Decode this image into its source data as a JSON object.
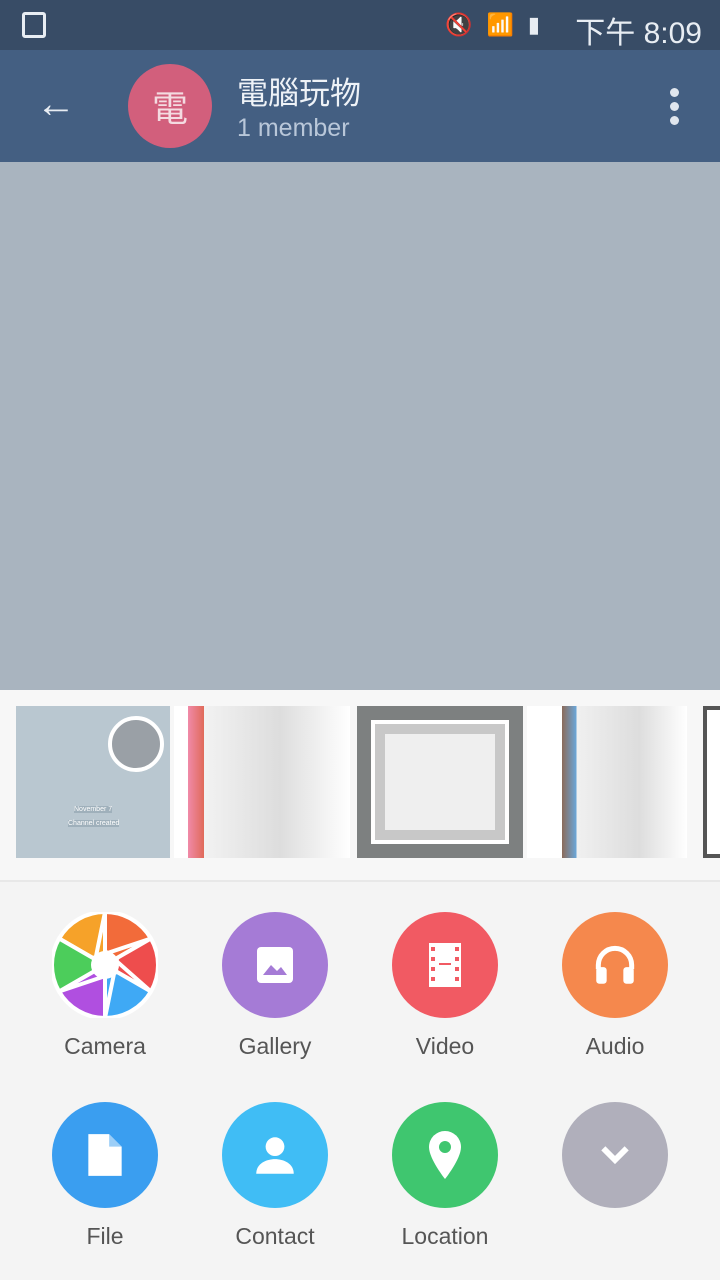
{
  "status_bar": {
    "time": "下午 8:09",
    "icons": [
      "screenshot-icon",
      "vibrate-mute-icon",
      "wifi-icon",
      "signal-icon",
      "battery-icon"
    ]
  },
  "header": {
    "avatar_letter": "電",
    "title": "電腦玩物",
    "subtitle": "1 member",
    "avatar_color": "#d25f7c"
  },
  "thumbnails": {
    "first_caption_1": "November 7",
    "first_caption_2": "Channel created"
  },
  "attach": {
    "items": [
      {
        "label": "Camera",
        "icon": "camera-shutter-icon"
      },
      {
        "label": "Gallery",
        "icon": "image-icon",
        "color": "#a57bd6"
      },
      {
        "label": "Video",
        "icon": "film-icon",
        "color": "#f15a63"
      },
      {
        "label": "Audio",
        "icon": "headphones-icon",
        "color": "#f5884d"
      },
      {
        "label": "File",
        "icon": "file-icon",
        "color": "#3a9ef0"
      },
      {
        "label": "Contact",
        "icon": "person-icon",
        "color": "#40bdf5"
      },
      {
        "label": "Location",
        "icon": "location-pin-icon",
        "color": "#3fc66f"
      },
      {
        "label": "",
        "icon": "chevron-down-icon",
        "color": "#b0afbb"
      }
    ]
  }
}
